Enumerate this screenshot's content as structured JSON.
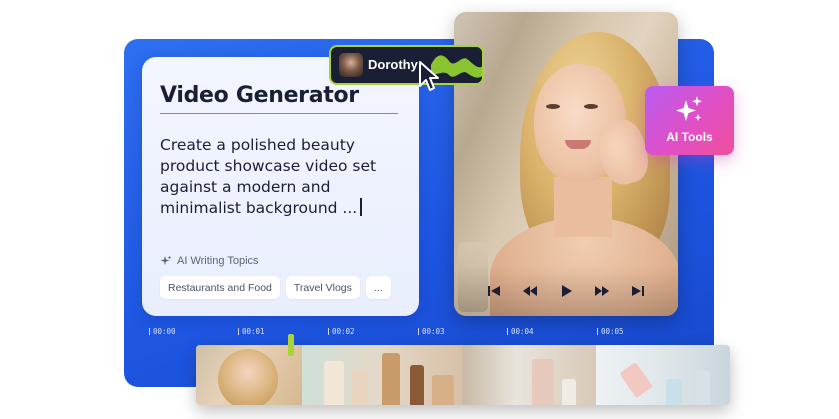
{
  "card": {
    "title": "Video Generator",
    "prompt": "Create a polished beauty product showcase video set against a modern and minimalist background ...",
    "topics_label": "AI Writing Topics",
    "chips": [
      "Restaurants and Food",
      "Travel Vlogs",
      "..."
    ]
  },
  "user_tag": {
    "name": "Dorothy",
    "accent_color": "#a8d43a"
  },
  "ai_tools": {
    "label": "AI Tools",
    "icon": "sparkles-icon"
  },
  "timeline": {
    "ticks": [
      "00:00",
      "00:01",
      "00:02",
      "00:03",
      "00:04",
      "00:05"
    ]
  },
  "player": {
    "controls": [
      "skip-start-icon",
      "rewind-icon",
      "play-icon",
      "fast-forward-icon",
      "skip-end-icon"
    ]
  },
  "colors": {
    "stage_blue": "#1e56e2",
    "card_bg": "#eef2fe",
    "ai_gradient_start": "#b95cf2",
    "ai_gradient_end": "#f04f9a"
  }
}
